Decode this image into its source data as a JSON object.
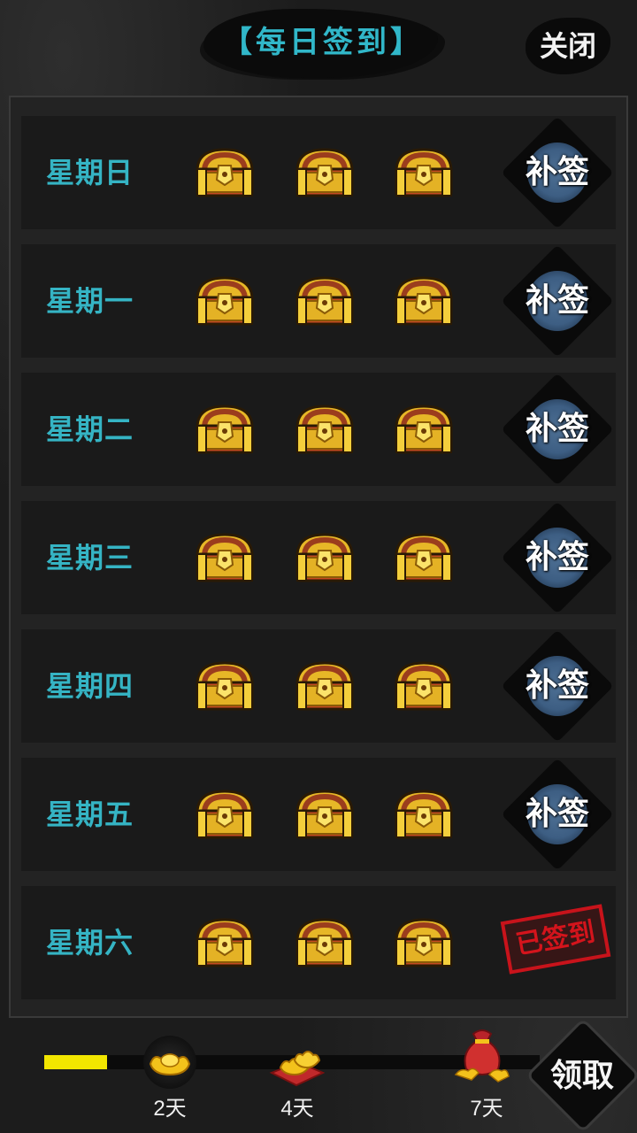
{
  "header": {
    "title": "【每日签到】",
    "close_label": "关闭"
  },
  "days": [
    {
      "label": "星期日",
      "status": "补签"
    },
    {
      "label": "星期一",
      "status": "补签"
    },
    {
      "label": "星期二",
      "status": "补签"
    },
    {
      "label": "星期三",
      "status": "补签"
    },
    {
      "label": "星期四",
      "status": "补签"
    },
    {
      "label": "星期五",
      "status": "补签"
    },
    {
      "label": "星期六",
      "status": "已签到"
    }
  ],
  "chest_icon": "treasure-chest-icon",
  "progress": {
    "fill_fraction": 0.127,
    "fill_color": "#f2e600",
    "milestones": [
      {
        "label": "2天",
        "icon": "gold-ingot-icon"
      },
      {
        "label": "4天",
        "icon": "gold-ingot-pile-icon"
      },
      {
        "label": "7天",
        "icon": "treasure-bag-icon"
      }
    ]
  },
  "claim_label": "领取",
  "colors": {
    "accent": "#35b4c4",
    "stamp": "#d4141c",
    "makeup_ink": "#3d5e83"
  }
}
